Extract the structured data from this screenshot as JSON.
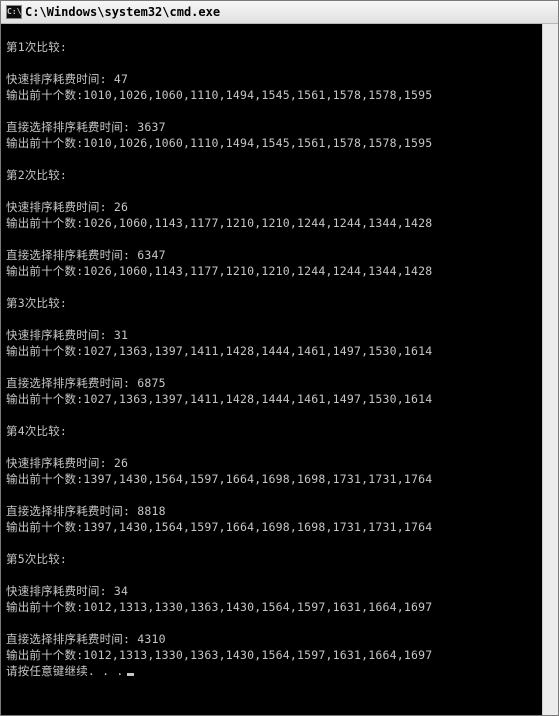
{
  "window": {
    "title": "C:\\Windows\\system32\\cmd.exe",
    "icon_text": "C:\\"
  },
  "console": {
    "lines": [
      "第1次比较:",
      "",
      "快速排序耗费时间: 47",
      "输出前十个数:1010,1026,1060,1110,1494,1545,1561,1578,1578,1595",
      "",
      "直接选择排序耗费时间: 3637",
      "输出前十个数:1010,1026,1060,1110,1494,1545,1561,1578,1578,1595",
      "",
      "第2次比较:",
      "",
      "快速排序耗费时间: 26",
      "输出前十个数:1026,1060,1143,1177,1210,1210,1244,1244,1344,1428",
      "",
      "直接选择排序耗费时间: 6347",
      "输出前十个数:1026,1060,1143,1177,1210,1210,1244,1244,1344,1428",
      "",
      "第3次比较:",
      "",
      "快速排序耗费时间: 31",
      "输出前十个数:1027,1363,1397,1411,1428,1444,1461,1497,1530,1614",
      "",
      "直接选择排序耗费时间: 6875",
      "输出前十个数:1027,1363,1397,1411,1428,1444,1461,1497,1530,1614",
      "",
      "第4次比较:",
      "",
      "快速排序耗费时间: 26",
      "输出前十个数:1397,1430,1564,1597,1664,1698,1698,1731,1731,1764",
      "",
      "直接选择排序耗费时间: 8818",
      "输出前十个数:1397,1430,1564,1597,1664,1698,1698,1731,1731,1764",
      "",
      "第5次比较:",
      "",
      "快速排序耗费时间: 34",
      "输出前十个数:1012,1313,1330,1363,1430,1564,1597,1631,1664,1697",
      "",
      "直接选择排序耗费时间: 4310",
      "输出前十个数:1012,1313,1330,1363,1430,1564,1597,1631,1664,1697",
      "请按任意键继续. . ."
    ]
  },
  "colors": {
    "background": "#000000",
    "text": "#c6c6c6",
    "titlebar": "#e6e6e6"
  }
}
